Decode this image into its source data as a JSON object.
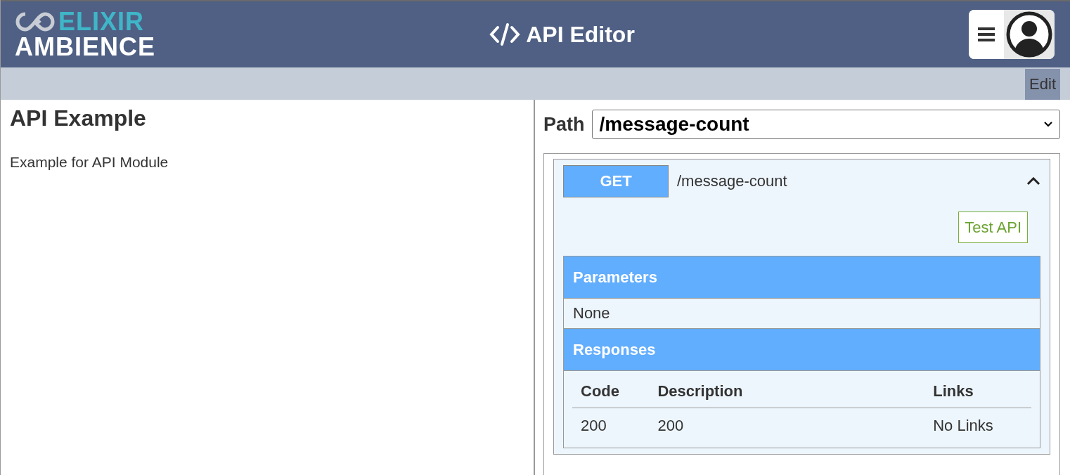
{
  "header": {
    "logo": {
      "top": "ELIXIR",
      "bottom": "AMBIENCE"
    },
    "title": "API Editor"
  },
  "toolbar": {
    "buttons": [
      "Edit"
    ]
  },
  "document": {
    "title": "API Example",
    "description": "Example for API Module"
  },
  "path_selector": {
    "label": "Path",
    "value": "/message-count"
  },
  "endpoint": {
    "method": "GET",
    "path": "/message-count",
    "expanded": true,
    "test_button": "Test API",
    "parameters": {
      "title": "Parameters",
      "body": "None"
    },
    "responses": {
      "title": "Responses",
      "columns": [
        "Code",
        "Description",
        "Links"
      ],
      "rows": [
        [
          "200",
          "200",
          "No Links"
        ]
      ]
    }
  }
}
